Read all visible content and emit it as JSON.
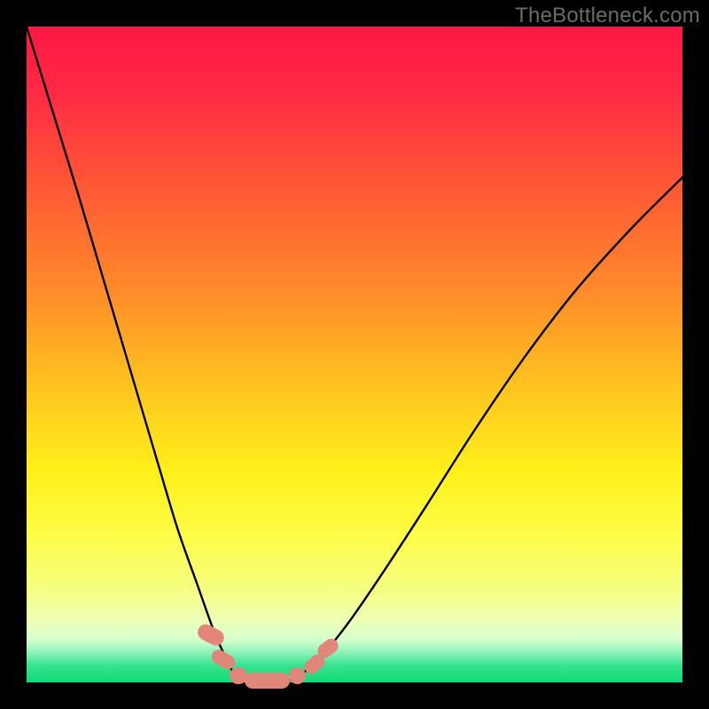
{
  "watermark": {
    "text": "TheBottleneck.com"
  },
  "chart_data": {
    "type": "line",
    "title": "",
    "xlabel": "",
    "ylabel": "",
    "xlim": [
      0,
      1
    ],
    "ylim": [
      0,
      1
    ],
    "description": "Bottleneck curve over a red-to-green vertical gradient. Two branches descend from top-left and upper-right toward a flat-bottom trough near x≈0.33–0.40.",
    "gradient_stops": [
      {
        "pos": 0.0,
        "color": "#ff1744"
      },
      {
        "pos": 0.1,
        "color": "#ff2a44"
      },
      {
        "pos": 0.25,
        "color": "#ff5a34"
      },
      {
        "pos": 0.4,
        "color": "#ff8a2a"
      },
      {
        "pos": 0.55,
        "color": "#ffc41f"
      },
      {
        "pos": 0.68,
        "color": "#fff01a"
      },
      {
        "pos": 0.78,
        "color": "#fdfd4a"
      },
      {
        "pos": 0.86,
        "color": "#f5ff83"
      },
      {
        "pos": 0.905,
        "color": "#edffb5"
      },
      {
        "pos": 0.935,
        "color": "#d6ffce"
      },
      {
        "pos": 0.955,
        "color": "#8af2b8"
      },
      {
        "pos": 0.975,
        "color": "#36e38e"
      },
      {
        "pos": 1.0,
        "color": "#14d977"
      }
    ],
    "series": [
      {
        "name": "left-branch",
        "x": [
          0.0,
          0.04,
          0.08,
          0.12,
          0.16,
          0.2,
          0.23,
          0.26,
          0.285,
          0.305,
          0.32
        ],
        "y": [
          1.0,
          0.87,
          0.74,
          0.605,
          0.47,
          0.335,
          0.235,
          0.15,
          0.08,
          0.035,
          0.01
        ]
      },
      {
        "name": "trough",
        "x": [
          0.32,
          0.345,
          0.37,
          0.395,
          0.415
        ],
        "y": [
          0.01,
          0.003,
          0.002,
          0.003,
          0.01
        ]
      },
      {
        "name": "right-branch",
        "x": [
          0.415,
          0.445,
          0.49,
          0.545,
          0.61,
          0.68,
          0.755,
          0.835,
          0.92,
          1.0
        ],
        "y": [
          0.01,
          0.035,
          0.09,
          0.17,
          0.27,
          0.38,
          0.49,
          0.595,
          0.69,
          0.77
        ]
      }
    ],
    "markers": [
      {
        "cx": 0.281,
        "cy": 0.072,
        "rx": 0.012,
        "ry": 0.021,
        "angle_deg": -63
      },
      {
        "cx": 0.3,
        "cy": 0.035,
        "rx": 0.011,
        "ry": 0.019,
        "angle_deg": -60
      },
      {
        "cx": 0.323,
        "cy": 0.01,
        "rx": 0.013,
        "ry": 0.013,
        "angle_deg": 0
      },
      {
        "cx": 0.367,
        "cy": 0.003,
        "rx": 0.034,
        "ry": 0.012,
        "angle_deg": 0
      },
      {
        "cx": 0.413,
        "cy": 0.01,
        "rx": 0.013,
        "ry": 0.013,
        "angle_deg": 0
      },
      {
        "cx": 0.44,
        "cy": 0.028,
        "rx": 0.011,
        "ry": 0.017,
        "angle_deg": 50
      },
      {
        "cx": 0.46,
        "cy": 0.052,
        "rx": 0.011,
        "ry": 0.017,
        "angle_deg": 52
      }
    ]
  }
}
